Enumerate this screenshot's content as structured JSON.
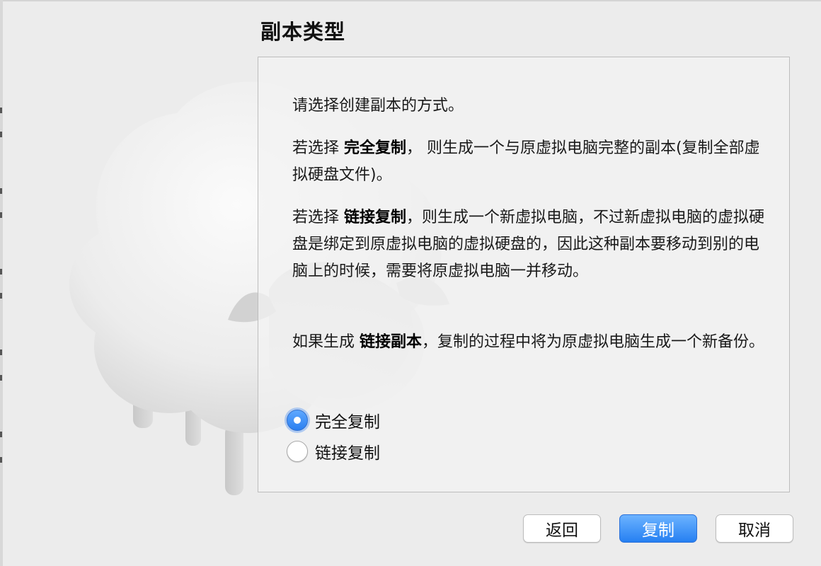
{
  "page": {
    "title": "副本类型"
  },
  "description": {
    "intro": "请选择创建副本的方式。",
    "full_prefix": "若选择 ",
    "full_bold": "完全复制",
    "full_rest": "， 则生成一个与原虚拟电脑完整的副本(复制全部虚拟硬盘文件)。",
    "linked_prefix": "若选择 ",
    "linked_bold": "链接复制",
    "linked_rest": "，则生成一个新虚拟电脑，不过新虚拟电脑的虚拟硬盘是绑定到原虚拟电脑的虚拟硬盘的，因此这种副本要移动到别的电脑上的时候，需要将原虚拟电脑一并移动。",
    "snapshot_prefix": "如果生成 ",
    "snapshot_bold": "链接副本",
    "snapshot_rest": "，复制的过程中将为原虚拟电脑生成一个新备份。"
  },
  "options": {
    "full_clone": {
      "label": "完全复制",
      "selected": true
    },
    "linked_clone": {
      "label": "链接复制",
      "selected": false
    }
  },
  "buttons": {
    "back": "返回",
    "copy": "复制",
    "cancel": "取消"
  },
  "colors": {
    "accent": "#2b7ff0",
    "window_bg": "#ececec"
  }
}
